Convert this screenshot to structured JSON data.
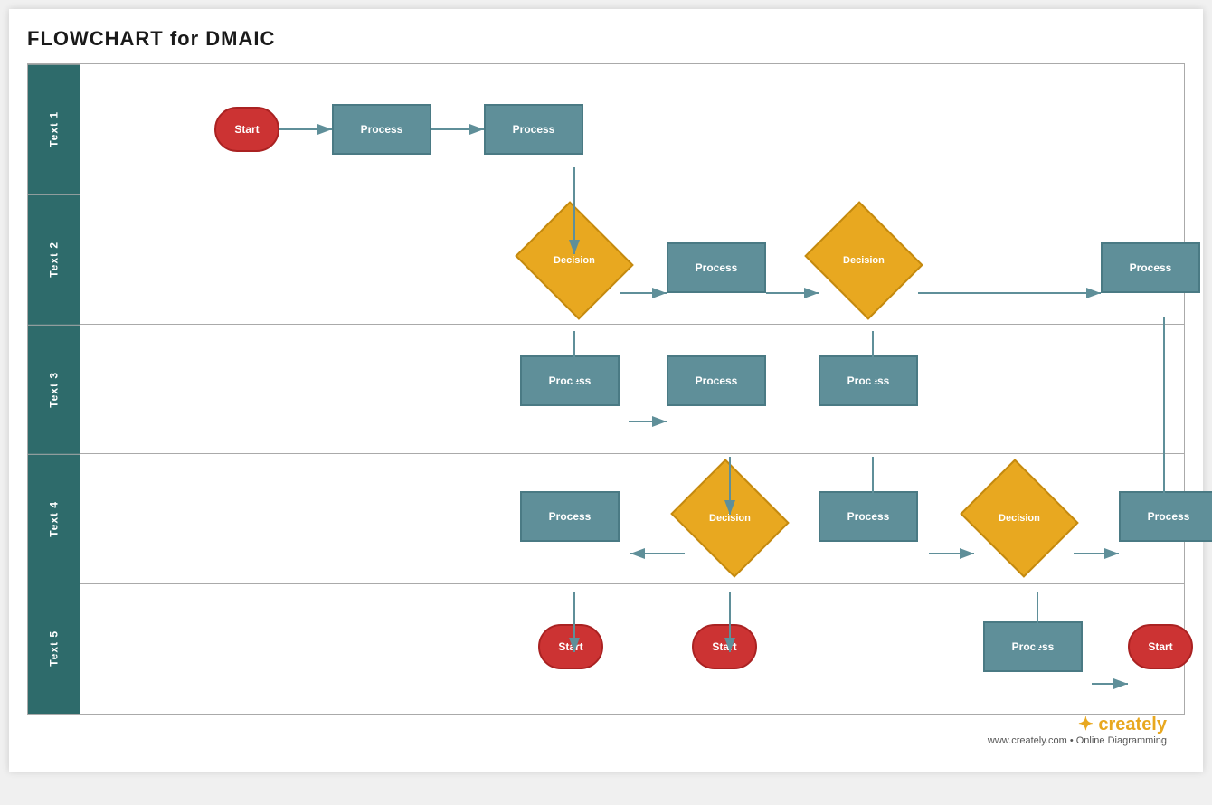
{
  "title": "FLOWCHART for DMAIC",
  "sidebar": {
    "labels": [
      "Text 1",
      "Text 2",
      "Text 3",
      "Text 4",
      "Text 5"
    ]
  },
  "shapes": {
    "start1": {
      "label": "Start",
      "type": "start-end"
    },
    "process1": {
      "label": "Process",
      "type": "process"
    },
    "process2": {
      "label": "Process",
      "type": "process"
    },
    "decision1": {
      "label": "Decision",
      "type": "decision"
    },
    "process3": {
      "label": "Process",
      "type": "process"
    },
    "decision2": {
      "label": "Decision",
      "type": "decision"
    },
    "process4": {
      "label": "Process",
      "type": "process"
    },
    "process5": {
      "label": "Process",
      "type": "process"
    },
    "process6": {
      "label": "Process",
      "type": "process"
    },
    "process7": {
      "label": "Process",
      "type": "process"
    },
    "decision3": {
      "label": "Decision",
      "type": "decision"
    },
    "process8": {
      "label": "Process",
      "type": "process"
    },
    "process9": {
      "label": "Process",
      "type": "process"
    },
    "decision4": {
      "label": "Decision",
      "type": "decision"
    },
    "process10": {
      "label": "Process",
      "type": "process"
    },
    "start2": {
      "label": "Start",
      "type": "start-end"
    },
    "start3": {
      "label": "Start",
      "type": "start-end"
    },
    "process11": {
      "label": "Process",
      "type": "process"
    },
    "start4": {
      "label": "Start",
      "type": "start-end"
    }
  },
  "creately": {
    "brand": "creately",
    "dot": "•",
    "tagline": "Online Diagramming",
    "url": "www.creately.com"
  }
}
